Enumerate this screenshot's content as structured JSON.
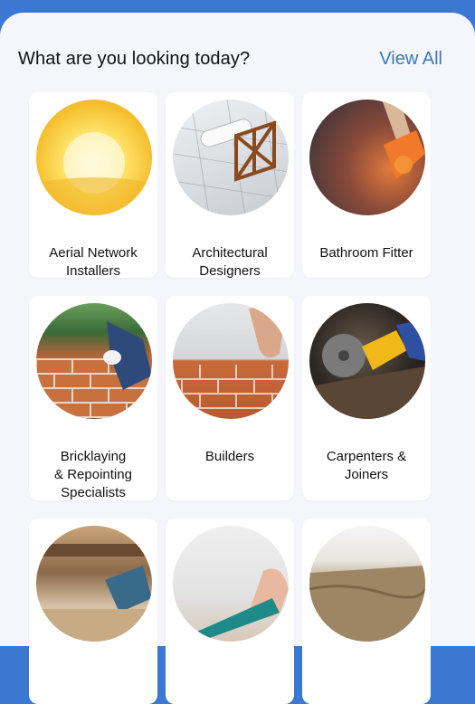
{
  "header": {
    "title": "What are you looking today?",
    "view_all": "View All"
  },
  "categories": [
    {
      "label_lines": [
        "Aerial Network",
        "Installers"
      ],
      "icon": "aerial-installer-photo"
    },
    {
      "label_lines": [
        "Architectural",
        "Designers"
      ],
      "icon": "architect-blueprints-photo"
    },
    {
      "label_lines": [
        "Bathroom Fitter"
      ],
      "icon": "bathroom-fitter-photo"
    },
    {
      "label_lines": [
        "Bricklaying",
        "& Repointing",
        "Specialists"
      ],
      "icon": "bricklaying-photo"
    },
    {
      "label_lines": [
        "Builders"
      ],
      "icon": "builders-photo"
    },
    {
      "label_lines": [
        "Carpenters &",
        "Joiners"
      ],
      "icon": "carpenter-grinder-photo"
    },
    {
      "label_lines": [],
      "icon": "woodworking-photo"
    },
    {
      "label_lines": [],
      "icon": "flooring-photo"
    },
    {
      "label_lines": [],
      "icon": "landscaping-photo"
    }
  ],
  "colors": {
    "top_bar": "#3a78d4",
    "sheet_background": "#f4f6fb",
    "link": "#3a78b8"
  }
}
